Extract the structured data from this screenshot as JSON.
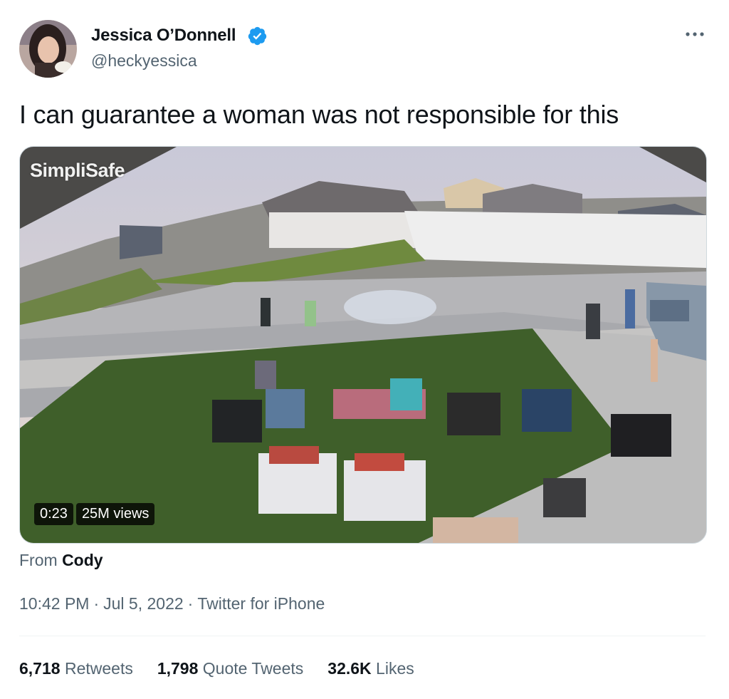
{
  "author": {
    "name": "Jessica O’Donnell",
    "handle": "@heckyessica",
    "verified": true
  },
  "tweet": {
    "text": "I can guarantee a woman was not responsible for this"
  },
  "media": {
    "watermark": "SimpliSafe",
    "duration": "0:23",
    "views": "25M views"
  },
  "source": {
    "prefix": "From",
    "user": "Cody"
  },
  "meta": {
    "time": "10:42 PM",
    "date": "Jul 5, 2022",
    "client": "Twitter for iPhone"
  },
  "stats": [
    {
      "value": "6,718",
      "label": "Retweets"
    },
    {
      "value": "1,798",
      "label": "Quote Tweets"
    },
    {
      "value": "32.6K",
      "label": "Likes"
    }
  ],
  "icons": {
    "verified": "verified-badge-icon",
    "more": "more-options-icon"
  },
  "colors": {
    "verified_blue": "#1d9bf0",
    "secondary_text": "#536471",
    "primary_text": "#0f1419"
  }
}
